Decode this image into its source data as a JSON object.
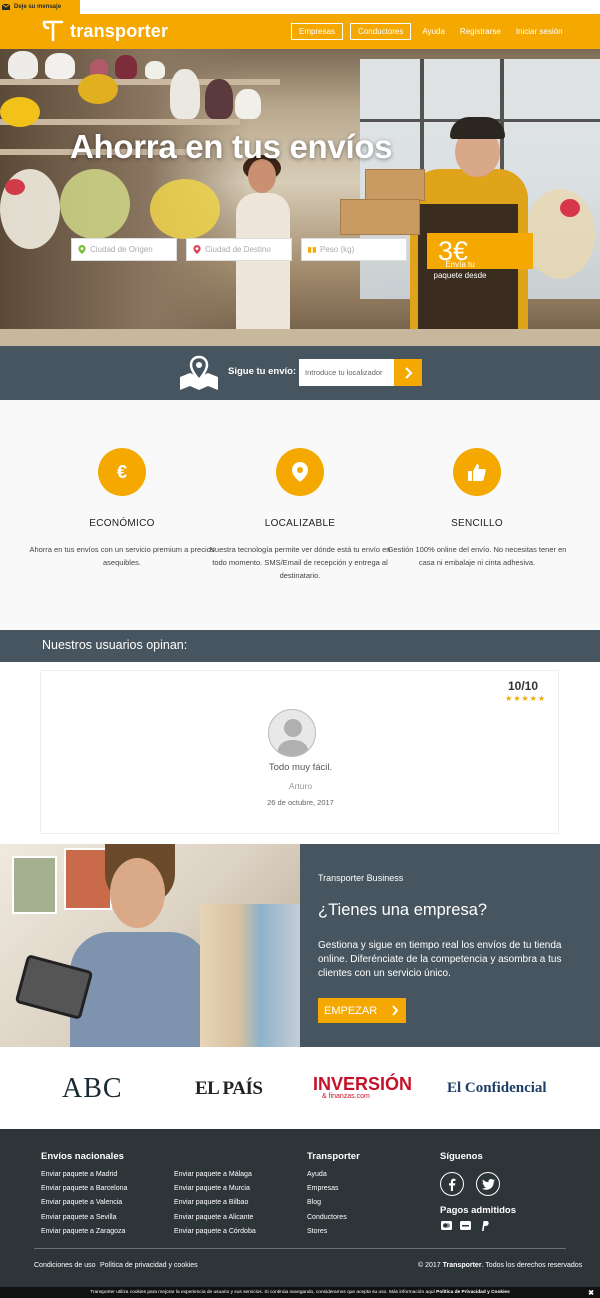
{
  "top_message": {
    "label": "Deje su mensaje"
  },
  "header": {
    "brand": "transporter",
    "nav_buttons": [
      "Empresas",
      "Conductores"
    ],
    "nav_links": [
      "Ayuda",
      "Registrarse",
      "Iniciar sesión"
    ]
  },
  "hero": {
    "title": "Ahorra en tus envíos",
    "origin_placeholder": "Ciudad de Origen",
    "destination_placeholder": "Ciudad de Destino",
    "weight_placeholder": "Peso (kg)",
    "price_label": "Envía tu paquete desde",
    "price_value": "3€"
  },
  "tracking": {
    "label": "Sigue tu envío:",
    "input_placeholder": "Introduce tu localizador"
  },
  "features": [
    {
      "title": "ECONÓMICO",
      "text": "Ahorra en tus envíos con un servicio premium a precios asequibles.",
      "icon": "euro-icon"
    },
    {
      "title": "LOCALIZABLE",
      "text": "Nuestra tecnología permite ver dónde está tu envío en todo momento. SMS/Email de recepción y entrega al destinatario.",
      "icon": "location-pin-icon"
    },
    {
      "title": "SENCILLO",
      "text": "Gestión 100% online del envío. No necesitas tener en casa ni embalaje ni cinta adhesiva.",
      "icon": "thumbs-up-icon"
    }
  ],
  "opinions": {
    "heading": "Nuestros usuarios opinan:",
    "score": "10/10",
    "stars": "★★★★★",
    "rating": 5,
    "quote": "Todo muy fácil.",
    "author": "Arturo",
    "date": "26 de octubre, 2017"
  },
  "business": {
    "kicker": "Transporter Business",
    "title": "¿Tienes una empresa?",
    "text": "Gestiona y sigue en tiempo real los envíos de tu tienda online. Diferénciate de la competencia y asombra a tus clientes con un servicio único.",
    "button": "EMPEZAR"
  },
  "press": {
    "abc": "ABC",
    "elpais": "EL PAÍS",
    "inversion": "INVERSIÓN",
    "inversion_sub": "& finanzas.com",
    "confidencial": "El Confidencial"
  },
  "footer": {
    "col1_title": "Envíos nacionales",
    "col1_links": [
      "Enviar paquete a Madrid",
      "Enviar paquete a Barcelona",
      "Enviar paquete a Valencia",
      "Enviar paquete a Sevilla",
      "Enviar paquete a Zaragoza"
    ],
    "col2_links": [
      "Enviar paquete a Málaga",
      "Enviar paquete a Murcia",
      "Enviar paquete a Bilbao",
      "Enviar paquete a Alicante",
      "Enviar paquete a Córdoba"
    ],
    "col3_title": "Transporter",
    "col3_links": [
      "Ayuda",
      "Empresas",
      "Blog",
      "Conductores",
      "Stores"
    ],
    "social_title": "Síguenos",
    "payments_title": "Pagos admitidos",
    "legal_links": [
      "Condiciones de uso",
      "Política de privacidad y cookies"
    ],
    "copyright_prefix": "© 2017",
    "copyright_brand": "Transporter",
    "copyright_suffix": ". Todos los derechos reservados"
  },
  "cookie": {
    "text": "Transporter utiliza cookies para mejorar la experiencia de usuario y sus servicios. Si continúa navegando, consideramos que acepta su uso. Más información aquí",
    "link": "Política de Privacidad y Cookies",
    "close": "✖"
  },
  "colors": {
    "accent": "#f5a800",
    "dark": "#46555f",
    "footer": "#2e3539"
  }
}
